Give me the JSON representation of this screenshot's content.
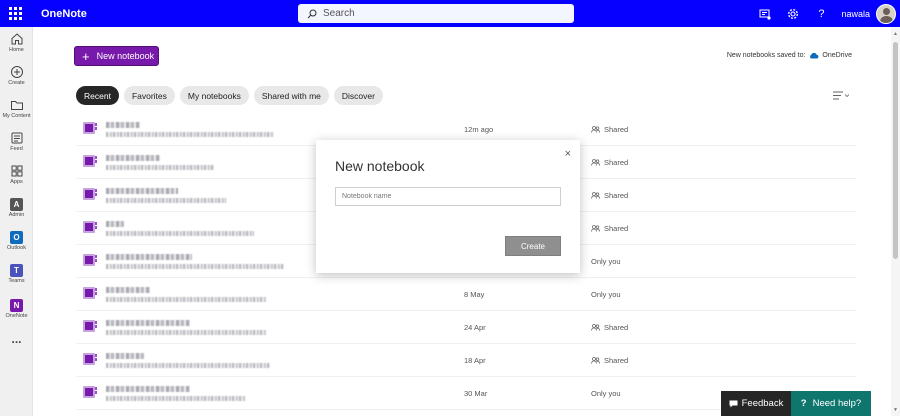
{
  "header": {
    "app_title": "OneNote",
    "search_placeholder": "Search",
    "user_name": "nawala",
    "icons": [
      "waffle-icon",
      "search-icon",
      "whats-new-icon",
      "gear-icon",
      "help-icon"
    ]
  },
  "rail": {
    "items": [
      {
        "label": "Home",
        "icon": "home-icon"
      },
      {
        "label": "Create",
        "icon": "create-icon"
      },
      {
        "label": "My Content",
        "icon": "folder-icon"
      },
      {
        "label": "Feed",
        "icon": "feed-icon"
      },
      {
        "label": "Apps",
        "icon": "apps-icon"
      },
      {
        "label": "Admin",
        "icon": "admin-icon",
        "letter": "A",
        "color": "#555555"
      },
      {
        "label": "Outlook",
        "icon": "outlook-icon",
        "letter": "O",
        "color": "#0f6cbd"
      },
      {
        "label": "Teams",
        "icon": "teams-icon",
        "letter": "T",
        "color": "#4b53bc"
      },
      {
        "label": "OneNote",
        "icon": "onenote-icon",
        "letter": "N",
        "color": "#7719aa"
      }
    ],
    "more": "..."
  },
  "toolbar": {
    "new_notebook": "New notebook",
    "saved_to_label": "New notebooks saved to:",
    "saved_to_location": "OneDrive"
  },
  "tabs": [
    {
      "label": "Recent",
      "active": true
    },
    {
      "label": "Favorites",
      "active": false
    },
    {
      "label": "My notebooks",
      "active": false
    },
    {
      "label": "Shared with me",
      "active": false
    },
    {
      "label": "Discover",
      "active": false
    }
  ],
  "notebooks": [
    {
      "when": "12m ago",
      "sharing": "Shared",
      "icon": "notebook-icon"
    },
    {
      "when": "",
      "sharing": "Shared",
      "icon": "notebook-icon"
    },
    {
      "when": "",
      "sharing": "Shared",
      "icon": "notebook-icon"
    },
    {
      "when": "",
      "sharing": "Shared",
      "icon": "notebook-icon"
    },
    {
      "when": "",
      "sharing": "Only you",
      "icon": "notebook-icon"
    },
    {
      "when": "8 May",
      "sharing": "Only you",
      "icon": "notebook-icon"
    },
    {
      "when": "24 Apr",
      "sharing": "Shared",
      "icon": "notebook-icon"
    },
    {
      "when": "18 Apr",
      "sharing": "Shared",
      "icon": "notebook-icon"
    },
    {
      "when": "30 Mar",
      "sharing": "Only you",
      "icon": "notebook-icon"
    }
  ],
  "dialog": {
    "title": "New notebook",
    "close": "×",
    "input_placeholder": "Notebook name",
    "input_value": "",
    "create_label": "Create"
  },
  "footer": {
    "feedback_label": "Feedback",
    "help_label": "Need help?"
  },
  "colors": {
    "header": "#0500ff",
    "accent": "#7719aa",
    "help": "#0f766e"
  }
}
